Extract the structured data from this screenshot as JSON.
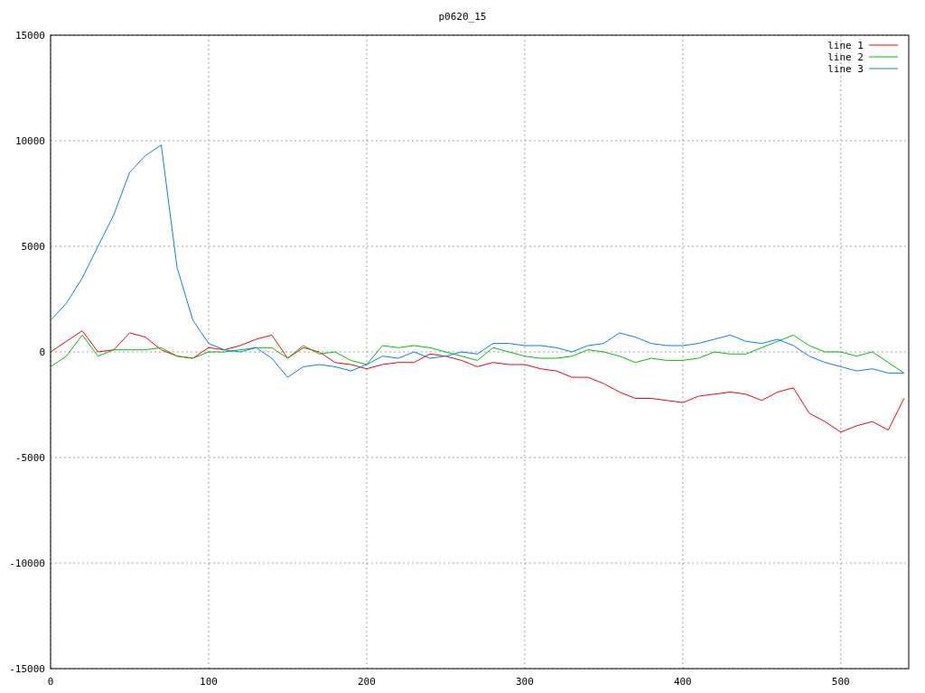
{
  "chart_data": {
    "type": "line",
    "title": "p0620_15",
    "grid": true,
    "legend": true,
    "xlim": [
      0,
      543
    ],
    "ylim": [
      -15000,
      15000
    ],
    "xticks": [
      0,
      100,
      200,
      300,
      400,
      500
    ],
    "yticks": [
      -15000,
      -10000,
      -5000,
      0,
      5000,
      10000,
      15000
    ],
    "x": [
      0,
      10,
      20,
      30,
      40,
      50,
      60,
      70,
      80,
      90,
      100,
      110,
      120,
      130,
      140,
      150,
      160,
      170,
      180,
      190,
      200,
      210,
      220,
      230,
      240,
      250,
      260,
      270,
      280,
      290,
      300,
      310,
      320,
      330,
      340,
      350,
      360,
      370,
      380,
      390,
      400,
      410,
      420,
      430,
      440,
      450,
      460,
      470,
      480,
      490,
      500,
      510,
      520,
      530,
      540
    ],
    "series": [
      {
        "name": "line 1",
        "color": "#ff0000",
        "values": [
          0,
          500,
          1000,
          0,
          100,
          900,
          700,
          100,
          -200,
          -300,
          200,
          100,
          300,
          600,
          800,
          -300,
          200,
          0,
          -500,
          -600,
          -800,
          -600,
          -500,
          -500,
          -100,
          -200,
          -400,
          -700,
          -500,
          -600,
          -600,
          -800,
          -900,
          -1200,
          -1200,
          -1500,
          -1900,
          -2200,
          -2200,
          -2300,
          -2400,
          -2100,
          -2000,
          -1900,
          -2000,
          -2300,
          -1900,
          -1700,
          -2900,
          -3300,
          -3800,
          -3500,
          -3300,
          -3700,
          -2200
        ]
      },
      {
        "name": "line 2",
        "color": "#00c000",
        "values": [
          -700,
          -200,
          800,
          -200,
          100,
          100,
          100,
          200,
          -200,
          -300,
          0,
          0,
          100,
          200,
          200,
          -300,
          300,
          -100,
          0,
          -400,
          -600,
          300,
          200,
          300,
          200,
          0,
          -200,
          -400,
          200,
          0,
          -200,
          -300,
          -300,
          -200,
          100,
          0,
          -200,
          -500,
          -300,
          -400,
          -400,
          -300,
          0,
          -100,
          -100,
          200,
          500,
          800,
          300,
          0,
          0,
          -200,
          0,
          -500,
          -1000
        ]
      },
      {
        "name": "line 3",
        "color": "#0080ff",
        "values": [
          1500,
          2300,
          3500,
          5000,
          6500,
          8500,
          9300,
          9800,
          4000,
          1500,
          400,
          100,
          0,
          200,
          -300,
          -1200,
          -700,
          -600,
          -700,
          -900,
          -600,
          -200,
          -300,
          0,
          -300,
          -200,
          0,
          -100,
          400,
          400,
          300,
          300,
          200,
          0,
          300,
          400,
          900,
          700,
          400,
          300,
          300,
          400,
          600,
          800,
          500,
          400,
          600,
          300,
          -200,
          -500,
          -700,
          -900,
          -800,
          -1000,
          -1000
        ]
      }
    ]
  }
}
